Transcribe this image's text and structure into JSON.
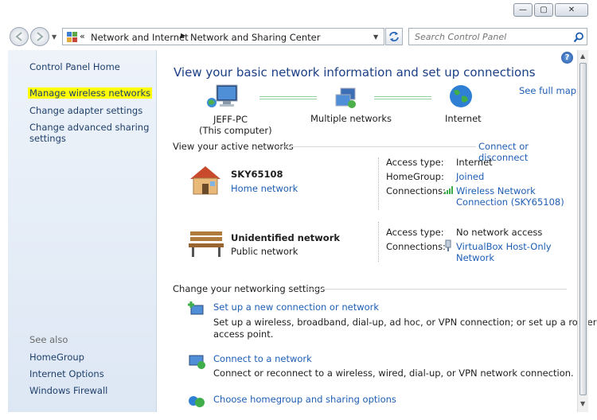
{
  "window": {
    "min_glyph": "—",
    "max_glyph": "▢",
    "close_glyph": "✕"
  },
  "nav": {
    "breadcrumb_chevron": "«",
    "breadcrumb": [
      "Network and Internet",
      "Network and Sharing Center"
    ],
    "search_placeholder": "Search Control Panel"
  },
  "sidebar": {
    "home": "Control Panel Home",
    "items": [
      "Manage wireless networks",
      "Change adapter settings",
      "Change advanced sharing",
      "settings"
    ],
    "see_also_title": "See also",
    "see_also": [
      "HomeGroup",
      "Internet Options",
      "Windows Firewall"
    ]
  },
  "main": {
    "heading": "View your basic network information and set up connections",
    "see_full_map": "See full map",
    "map": {
      "computer_name": "JEFF-PC",
      "computer_sub": "(This computer)",
      "middle": "Multiple networks",
      "internet": "Internet"
    },
    "active_title": "View your active networks",
    "connect_link": "Connect or disconnect",
    "networks": [
      {
        "name": "SKY65108",
        "type": "Home network",
        "access_label": "Access type:",
        "access_value": "Internet",
        "homegroup_label": "HomeGroup:",
        "homegroup_value": "Joined",
        "conn_label": "Connections:",
        "conn_value_1": "Wireless Network",
        "conn_value_2": "Connection (SKY65108)"
      },
      {
        "name": "Unidentified network",
        "type": "Public network",
        "access_label": "Access type:",
        "access_value": "No network access",
        "conn_label": "Connections:",
        "conn_value_1": "VirtualBox Host-Only",
        "conn_value_2": "Network"
      }
    ],
    "settings_title": "Change your networking settings",
    "tasks": [
      {
        "title": "Set up a new connection or network",
        "desc1": "Set up a wireless, broadband, dial-up, ad hoc, or VPN connection; or set up a router or",
        "desc2": "access point."
      },
      {
        "title": "Connect to a network",
        "desc1": "Connect or reconnect to a wireless, wired, dial-up, or VPN network connection."
      },
      {
        "title": "Choose homegroup and sharing options"
      }
    ],
    "help_glyph": "?"
  }
}
